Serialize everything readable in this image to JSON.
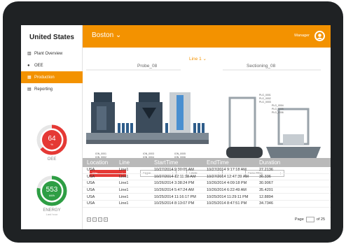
{
  "sidebar": {
    "country": "United States",
    "items": [
      {
        "label": "Plant Overview",
        "icon": "bar-chart-icon"
      },
      {
        "label": "OEE",
        "icon": "drop-icon"
      },
      {
        "label": "Production",
        "icon": "calendar-icon",
        "active": true
      },
      {
        "label": "Reporting",
        "icon": "document-icon"
      }
    ],
    "oee": {
      "value": "64",
      "unit": "%",
      "label": "OEE",
      "level": 0.64
    },
    "energy": {
      "value": "553",
      "unit": "kWh",
      "label": "ENERGY",
      "sublabel": "Last hour",
      "level": 0.78
    }
  },
  "header": {
    "city": "Boston",
    "user": "Manager"
  },
  "process": {
    "line": "Line 1",
    "stations": [
      "Probe_08",
      "Sectioning_08"
    ],
    "equipment_labels": [
      [
        "ION_0001",
        "ION_0002"
      ],
      [
        "ION_0003",
        "ION_0004"
      ],
      [
        "ION_0005",
        "ION_0006"
      ]
    ],
    "plc_labels_1": [
      "PLG_0001",
      "PLG_0002",
      "PLG_0003"
    ],
    "plc_labels_2": [
      "PLG_0004",
      "PLG_0005",
      "PLG_0006"
    ],
    "properties": [
      "Filler",
      "Capper",
      "Labeler",
      "Carton Filling"
    ]
  },
  "colors": {
    "accent": "#f39200",
    "oee": "#e53935",
    "energy": "#2e9e44"
  },
  "table": {
    "headers": [
      "Location",
      "Line",
      "StartTime",
      "EndTime",
      "Duration"
    ],
    "rows": [
      [
        "USA",
        "Line1",
        "10/27/2014 9:30:05 AM",
        "10/27/2014 9:17:18 AM",
        "27.2136"
      ],
      [
        "USA",
        "Line1",
        "10/27/2014 12:11:18 AM",
        "10/27/2014 12:47:39 AM",
        "36.336"
      ],
      [
        "USA",
        "Line1",
        "10/26/2014 3:38:24 PM",
        "10/26/2014 4:09:18 PM",
        "30.9067"
      ],
      [
        "USA",
        "Line1",
        "10/26/2014 5:47:24 AM",
        "10/26/2014 6:22:49 AM",
        "35.4201"
      ],
      [
        "USA",
        "Line1",
        "10/25/2014 11:16:17 PM",
        "10/25/2014 11:29:11 PM",
        "12.8894"
      ],
      [
        "USA",
        "Line1",
        "10/25/2014 8:13:07 PM",
        "10/25/2014 8:47:51 PM",
        "34.7346"
      ]
    ]
  },
  "pager": {
    "page_label": "Page",
    "of_label": "of 25"
  }
}
